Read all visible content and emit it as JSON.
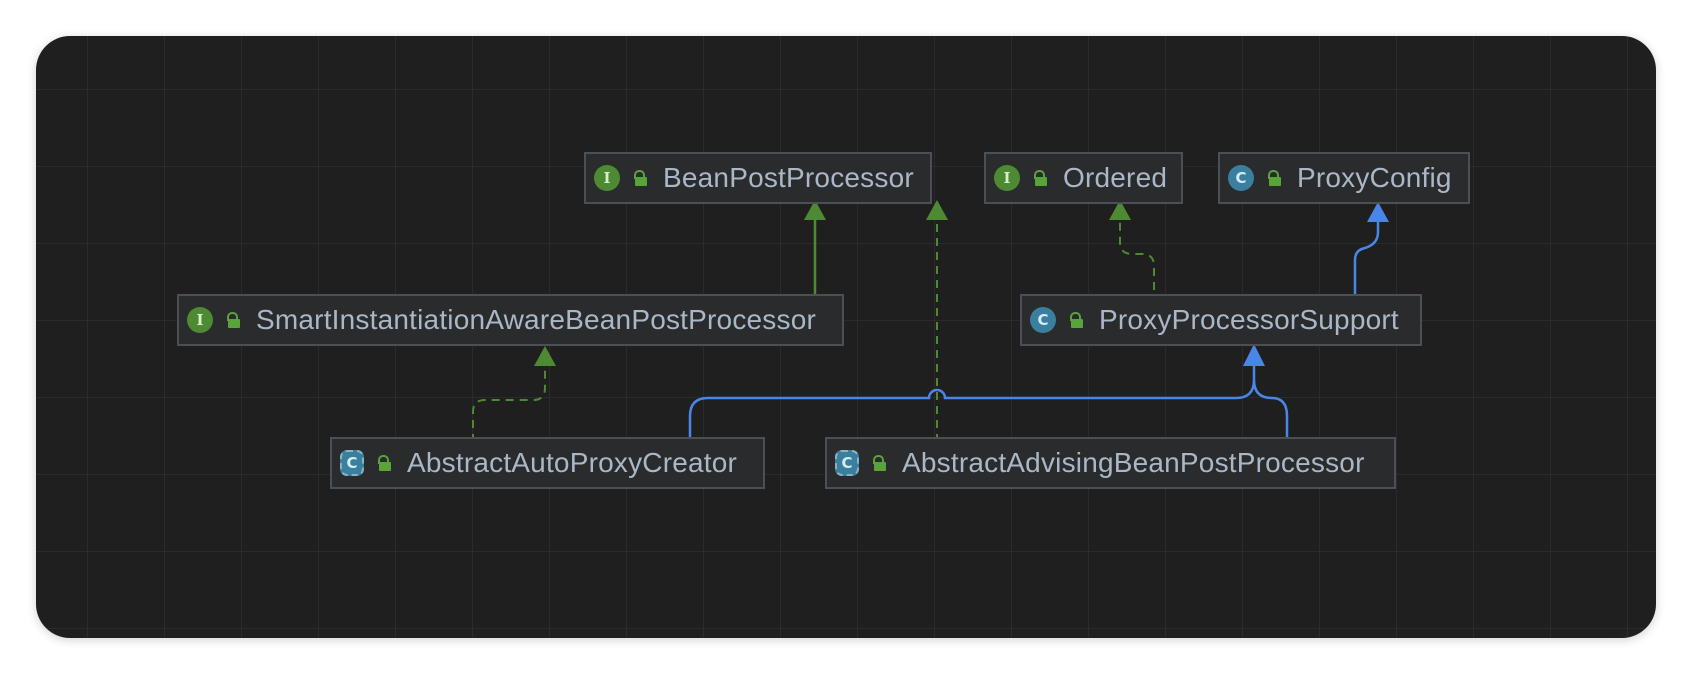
{
  "diagram": {
    "nodes": {
      "bean_post_processor": {
        "name": "BeanPostProcessor",
        "kind": "interface",
        "badge": "I"
      },
      "ordered": {
        "name": "Ordered",
        "kind": "interface",
        "badge": "I"
      },
      "proxy_config": {
        "name": "ProxyConfig",
        "kind": "class",
        "badge": "C"
      },
      "smart_instantiation": {
        "name": "SmartInstantiationAwareBeanPostProcessor",
        "kind": "interface",
        "badge": "I"
      },
      "proxy_processor_support": {
        "name": "ProxyProcessorSupport",
        "kind": "class",
        "badge": "C"
      },
      "abstract_auto_proxy_creator": {
        "name": "AbstractAutoProxyCreator",
        "kind": "abstract-class",
        "badge": "C"
      },
      "abstract_advising": {
        "name": "AbstractAdvisingBeanPostProcessor",
        "kind": "abstract-class",
        "badge": "C"
      }
    },
    "edges": [
      {
        "from": "smart_instantiation",
        "to": "bean_post_processor",
        "type": "extends-interface"
      },
      {
        "from": "abstract_advising",
        "to": "bean_post_processor",
        "type": "implements"
      },
      {
        "from": "proxy_processor_support",
        "to": "ordered",
        "type": "implements"
      },
      {
        "from": "proxy_processor_support",
        "to": "proxy_config",
        "type": "extends"
      },
      {
        "from": "abstract_auto_proxy_creator",
        "to": "smart_instantiation",
        "type": "implements"
      },
      {
        "from": "abstract_auto_proxy_creator",
        "to": "proxy_processor_support",
        "type": "extends"
      },
      {
        "from": "abstract_advising",
        "to": "proxy_processor_support",
        "type": "extends"
      }
    ],
    "colors": {
      "background": "#1f1f1f",
      "node_fill": "#2a2b2d",
      "node_border": "#4c4f53",
      "text": "#a9b7c6",
      "implements_edge": "#4e8a33",
      "extends_edge": "#4a86e8"
    }
  }
}
